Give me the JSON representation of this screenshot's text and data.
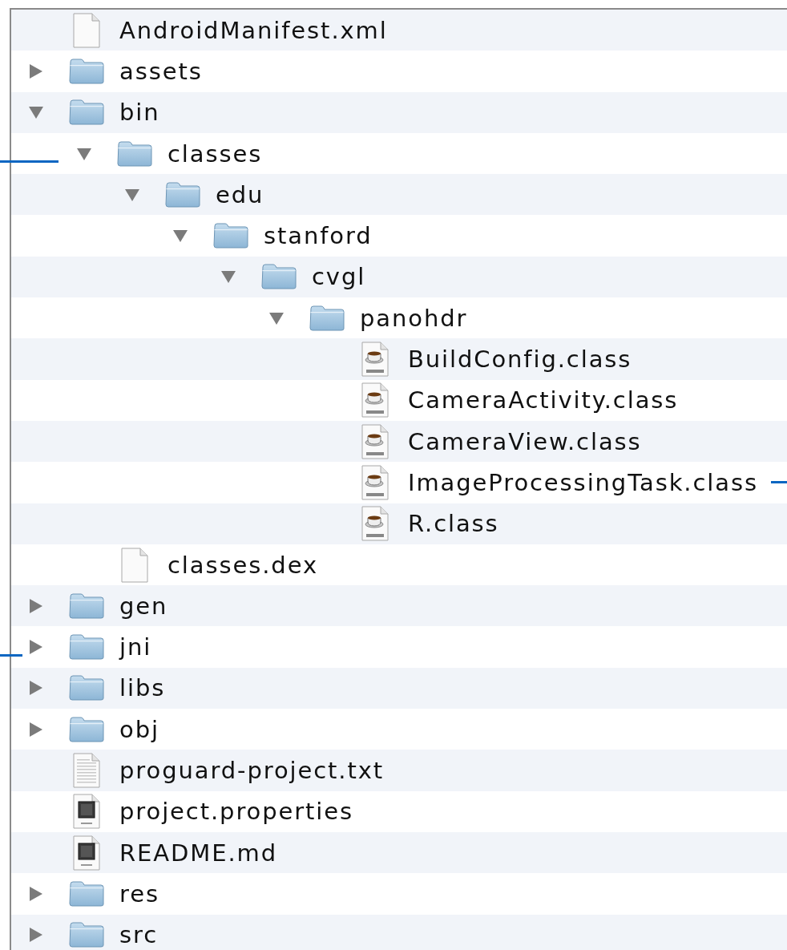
{
  "tree": [
    {
      "name": "AndroidManifest.xml",
      "kind": "file"
    },
    {
      "name": "assets",
      "kind": "folder",
      "expanded": false
    },
    {
      "name": "bin",
      "kind": "folder",
      "expanded": true,
      "children": [
        {
          "name": "classes",
          "kind": "folder",
          "expanded": true,
          "leader_left": true,
          "children": [
            {
              "name": "edu",
              "kind": "folder",
              "expanded": true,
              "children": [
                {
                  "name": "stanford",
                  "kind": "folder",
                  "expanded": true,
                  "children": [
                    {
                      "name": "cvgl",
                      "kind": "folder",
                      "expanded": true,
                      "children": [
                        {
                          "name": "panohdr",
                          "kind": "folder",
                          "expanded": true,
                          "children": [
                            {
                              "name": "BuildConfig.class",
                              "kind": "class"
                            },
                            {
                              "name": "CameraActivity.class",
                              "kind": "class"
                            },
                            {
                              "name": "CameraView.class",
                              "kind": "class"
                            },
                            {
                              "name": "ImageProcessingTask.class",
                              "kind": "class",
                              "leader_right": true
                            },
                            {
                              "name": "R.class",
                              "kind": "class"
                            }
                          ]
                        }
                      ]
                    }
                  ]
                }
              ]
            }
          ]
        },
        {
          "name": "classes.dex",
          "kind": "file"
        }
      ]
    },
    {
      "name": "gen",
      "kind": "folder",
      "expanded": false
    },
    {
      "name": "jni",
      "kind": "folder",
      "expanded": false,
      "leader_left": true
    },
    {
      "name": "libs",
      "kind": "folder",
      "expanded": false
    },
    {
      "name": "obj",
      "kind": "folder",
      "expanded": false
    },
    {
      "name": "proguard-project.txt",
      "kind": "text"
    },
    {
      "name": "project.properties",
      "kind": "binary"
    },
    {
      "name": "README.md",
      "kind": "binary"
    },
    {
      "name": "res",
      "kind": "folder",
      "expanded": false
    },
    {
      "name": "src",
      "kind": "folder",
      "expanded": false
    }
  ]
}
